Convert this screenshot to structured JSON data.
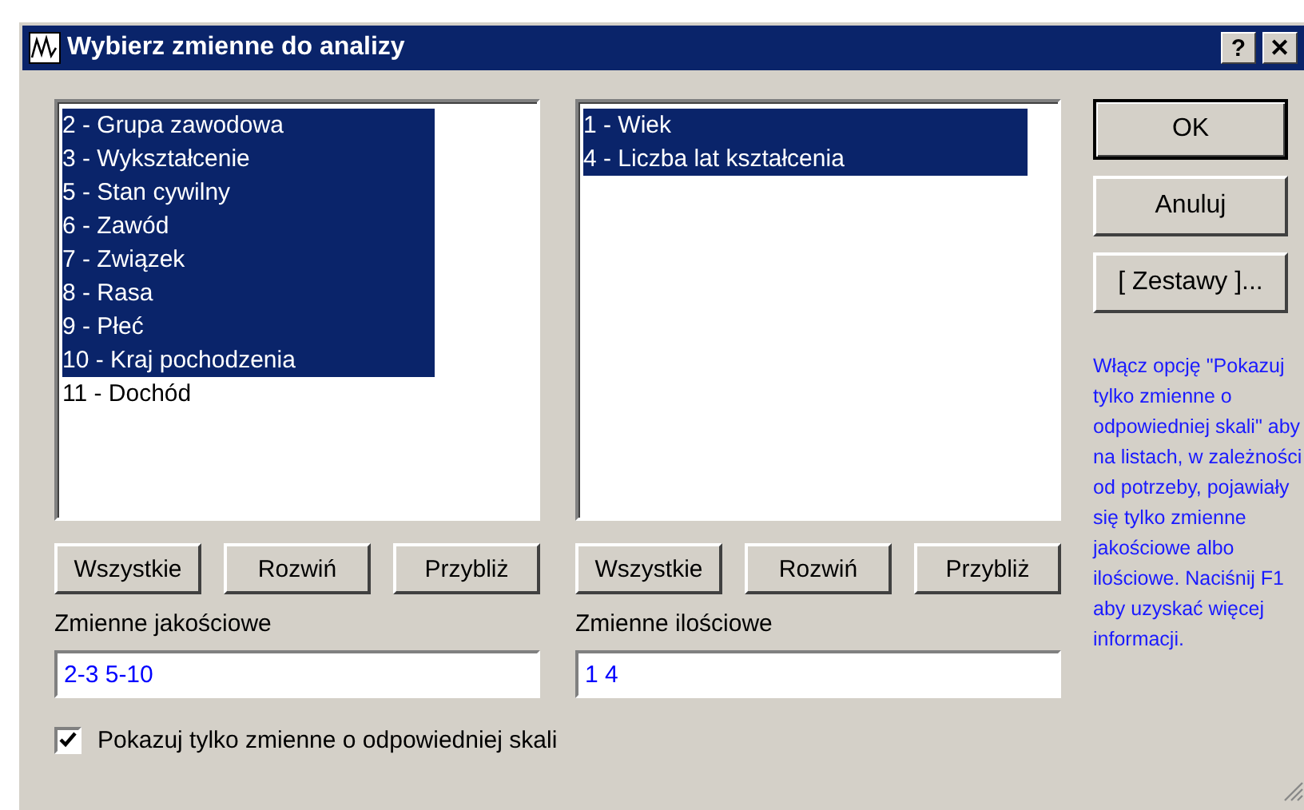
{
  "window": {
    "title": "Wybierz zmienne do analizy",
    "title_buttons": [
      "?",
      "✕"
    ]
  },
  "lists": [
    {
      "items": [
        {
          "label": "2 - Grupa zawodowa",
          "selected": true
        },
        {
          "label": "3 - Wykształcenie",
          "selected": true
        },
        {
          "label": "5 - Stan cywilny",
          "selected": true
        },
        {
          "label": "6 - Zawód",
          "selected": true
        },
        {
          "label": "7 - Związek",
          "selected": true
        },
        {
          "label": "8 - Rasa",
          "selected": true
        },
        {
          "label": "9 - Płeć",
          "selected": true
        },
        {
          "label": "10 - Kraj pochodzenia",
          "selected": true
        },
        {
          "label": "11 - Dochód",
          "selected": false
        }
      ],
      "buttons": [
        "Wszystkie",
        "Rozwiń",
        "Przybliż"
      ],
      "field_label": "Zmienne jakościowe",
      "field_value": "2-3 5-10"
    },
    {
      "items": [
        {
          "label": "1 - Wiek",
          "selected": true
        },
        {
          "label": "4 - Liczba lat kształcenia",
          "selected": true
        }
      ],
      "buttons": [
        "Wszystkie",
        "Rozwiń",
        "Przybliż"
      ],
      "field_label": "Zmienne ilościowe",
      "field_value": "1 4"
    }
  ],
  "side_buttons": [
    {
      "label": "OK",
      "default": true
    },
    {
      "label": "Anuluj",
      "default": false
    },
    {
      "label": "[ Zestawy ]...",
      "default": false
    }
  ],
  "help_text": "Włącz opcję \"Pokazuj tylko zmienne o odpowiedniej skali\" aby na listach, w zależności od potrzeby, pojawiały się tylko zmienne jakościowe albo ilościowe. Naciśnij F1 aby uzyskać więcej informacji.",
  "checkbox": {
    "label": "Pokazuj tylko zmienne o odpowiedniej skali",
    "checked": true
  }
}
